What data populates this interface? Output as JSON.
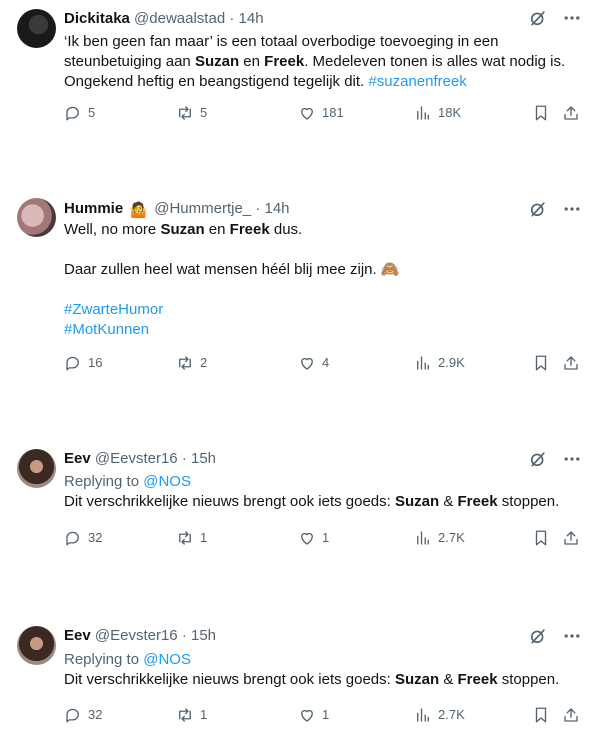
{
  "tweets": [
    {
      "name": "Dickitaka",
      "handle": "@dewaalstad",
      "time": "14h",
      "text_parts": [
        "‘Ik ben geen fan maar’ is een totaal overbodige toevoeging in een steunbetuiging aan ",
        "Suzan",
        " en ",
        "Freek",
        ". Medeleven tonen is alles wat nodig is. Ongekend heftig en beangstigend tegelijk dit. ",
        "#suzanenfreek"
      ],
      "replies": "5",
      "reposts": "5",
      "likes": "181",
      "views": "18K"
    },
    {
      "name": "Hummie",
      "name_emoji": "🤷",
      "handle": "@Hummertje_",
      "time": "14h",
      "line1_parts": [
        "Well, no more ",
        "Suzan",
        " en ",
        "Freek",
        " dus."
      ],
      "line2": "Daar zullen heel wat mensen héél blij mee zijn.",
      "line2_emoji": "🙈",
      "hashtags": [
        "#ZwarteHumor",
        "#MotKunnen"
      ],
      "replies": "16",
      "reposts": "2",
      "likes": "4",
      "views": "2.9K"
    },
    {
      "name": "Eev",
      "handle": "@Eevster16",
      "time": "15h",
      "replying_label": "Replying to ",
      "replying_to": "@NOS",
      "text_parts": [
        "Dit verschrikkelijke nieuws brengt ook iets goeds: ",
        "Suzan",
        " & ",
        "Freek",
        " stoppen."
      ],
      "replies": "32",
      "reposts": "1",
      "likes": "1",
      "views": "2.7K"
    },
    {
      "name": "Eev",
      "handle": "@Eevster16",
      "time": "15h",
      "replying_label": "Replying to ",
      "replying_to": "@NOS",
      "text_parts": [
        "Dit verschrikkelijke nieuws brengt ook iets goeds: ",
        "Suzan",
        " & ",
        "Freek",
        " stoppen."
      ],
      "replies": "32",
      "reposts": "1",
      "likes": "1",
      "views": "2.7K"
    }
  ],
  "separator": "·",
  "icons": [
    "grok-icon",
    "more-icon",
    "reply-icon",
    "repost-icon",
    "like-icon",
    "views-icon",
    "bookmark-icon",
    "share-icon"
  ]
}
